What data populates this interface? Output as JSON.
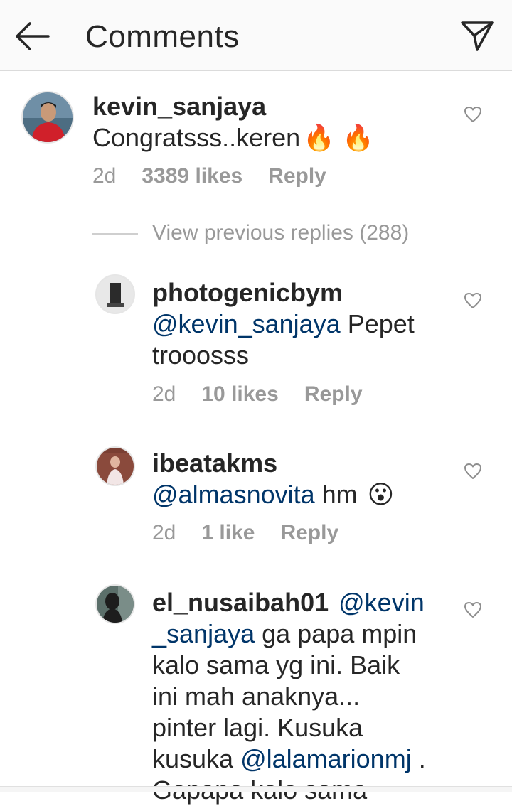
{
  "header": {
    "title": "Comments",
    "back_icon": "arrow-left-icon",
    "send_icon": "paper-plane-icon"
  },
  "main_comment": {
    "username": "kevin_sanjaya",
    "text": "Congratsss..keren",
    "emoji": "🔥 🔥",
    "time": "2d",
    "likes": "3389 likes",
    "reply": "Reply"
  },
  "view_previous": "View previous replies (288)",
  "replies": [
    {
      "username": "photogenicbym",
      "mention": "@kevin_sanjaya",
      "text_1": " Pepet",
      "text_2": "trooosss",
      "time": "2d",
      "likes": "10 likes",
      "reply": "Reply"
    },
    {
      "username": "ibeatakms",
      "mention": "@almasnovita",
      "text_1": " hm",
      "emoji": "😮",
      "time": "2d",
      "likes": "1 like",
      "reply": "Reply"
    },
    {
      "username": "el_nusaibah01",
      "mention_1a": "@kevin",
      "mention_1b": "_sanjaya",
      "text_2": " ga papa mpin",
      "text_3": "kalo sama yg ini. Baik",
      "text_4": "ini mah anaknya...",
      "text_5": "pinter lagi. Kusuka",
      "text_6": "kusuka ",
      "mention_2": "@lalamarionmj",
      "text_6b": " .",
      "text_7": "Gapapa kalo sama"
    }
  ],
  "colors": {
    "mention": "#003569",
    "meta": "#999999",
    "text": "#262626"
  }
}
